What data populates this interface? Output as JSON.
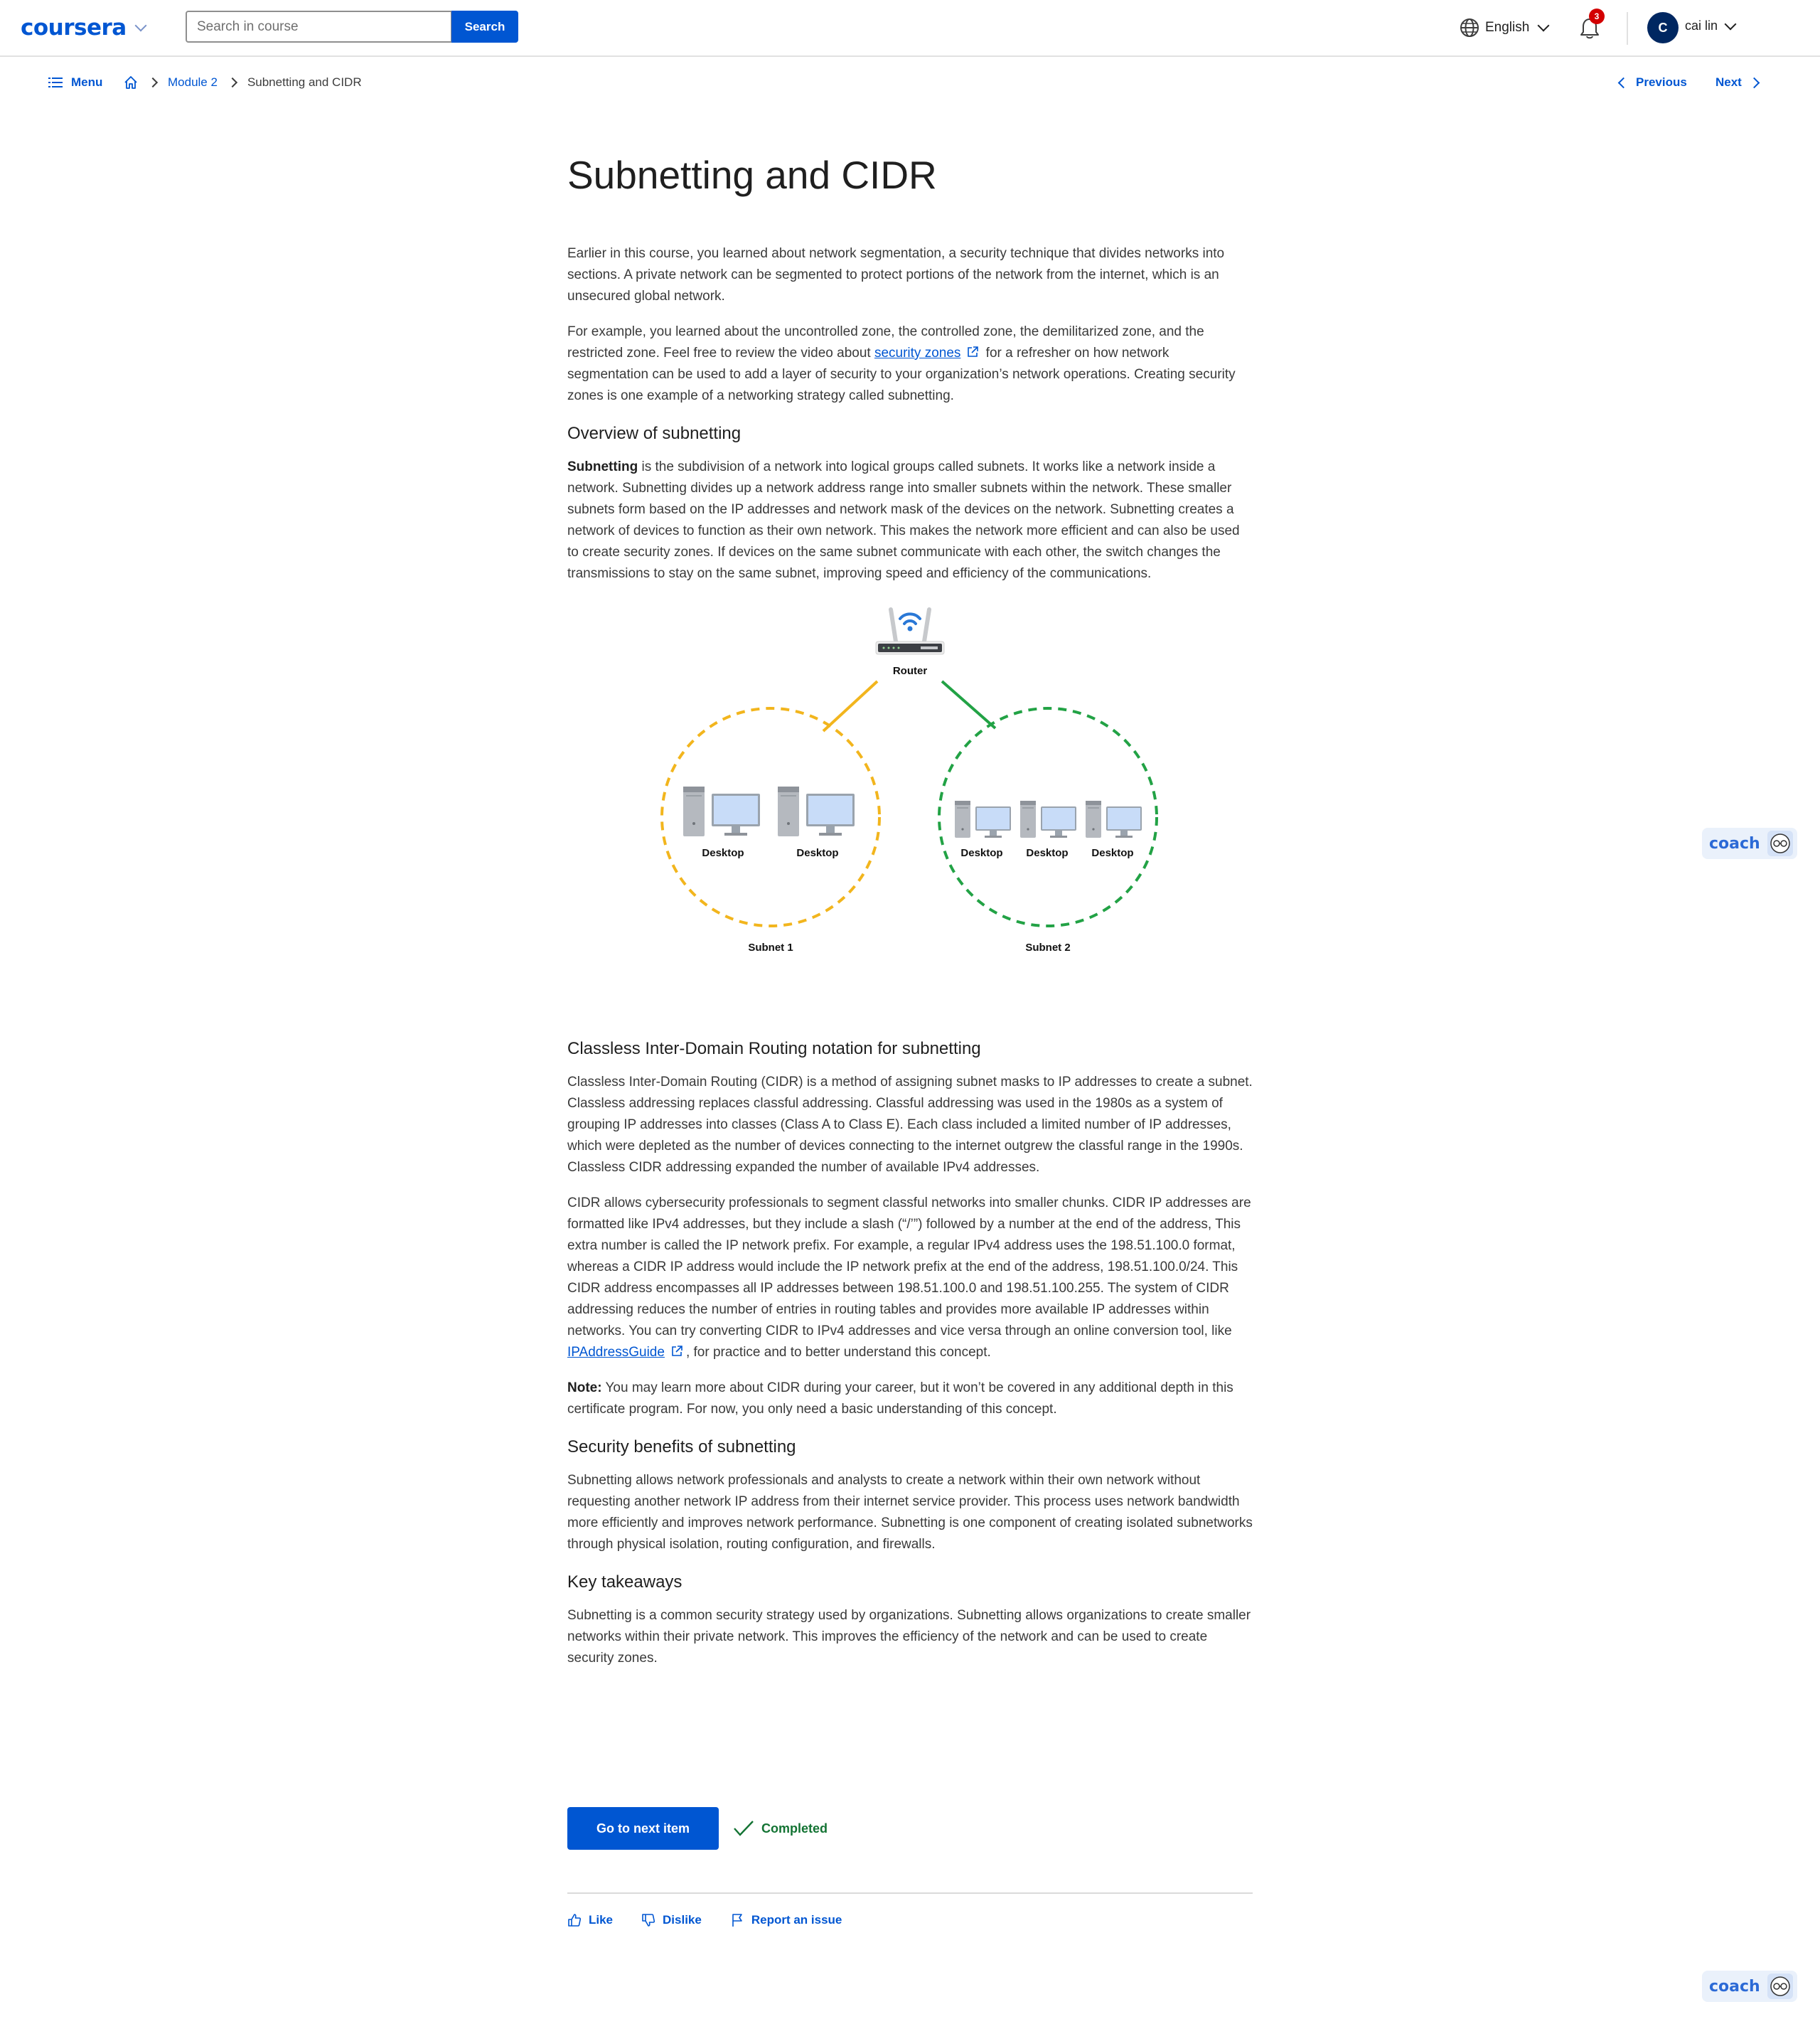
{
  "header": {
    "logo_text": "coursera",
    "search_placeholder": "Search in course",
    "search_button": "Search",
    "language": "English",
    "notification_count": "3",
    "avatar_initial": "C",
    "user_name": "cai lin"
  },
  "subnav": {
    "menu_label": "Menu",
    "breadcrumbs": [
      "Module 2",
      "Subnetting and CIDR"
    ],
    "previous_label": "Previous",
    "next_label": "Next"
  },
  "article": {
    "title": "Subnetting and CIDR",
    "intro_p1": "Earlier in this course, you learned about network segmentation, a security technique that divides networks into sections. A private network can be segmented to protect portions of the network from the internet, which is an unsecured global network.",
    "intro_p2_before": "For example, you learned about the uncontrolled zone, the controlled zone, the demilitarized zone, and the restricted zone. Feel free to review the video about ",
    "intro_p2_link": "security zones",
    "intro_p2_after": " for a refresher on how network segmentation can be used to add a layer of security to your organization’s network operations. Creating security zones is one example of a networking strategy called subnetting.",
    "h_overview": "Overview of subnetting",
    "overview_bold": "Subnetting",
    "overview_rest": " is the subdivision of a network into logical groups called subnets. It works like a network inside a network. Subnetting divides up a network address range into smaller subnets within the network. These smaller subnets form based on the IP addresses and network mask of the devices on the network. Subnetting creates a network of devices to function as their own network. This makes the network more efficient and can also be used to create security zones. If devices on the same subnet communicate with each other, the switch changes the transmissions to stay on the same subnet, improving speed and efficiency of the communications.",
    "h_cidr": "Classless Inter-Domain Routing notation for subnetting",
    "cidr_p1": "Classless Inter-Domain Routing (CIDR) is a method of assigning subnet masks to IP addresses to create a subnet. Classless addressing replaces classful addressing. Classful addressing was used in the 1980s as a system of grouping IP addresses into classes (Class A to Class E). Each class included a limited number of IP addresses, which were depleted as the number of devices connecting to the internet outgrew the classful range in the 1990s. Classless CIDR addressing expanded the number of available IPv4 addresses.",
    "cidr_p2_before": "CIDR allows cybersecurity professionals to segment classful networks into smaller chunks. CIDR IP addresses are formatted like IPv4 addresses, but they include a slash (“/’”) followed by a number at the end of the address, This extra number is called the IP network prefix.  For example, a regular IPv4 address uses the 198.51.100.0 format, whereas a CIDR IP address would include the IP network prefix at the end of the address, 198.51.100.0/24. This CIDR address encompasses all IP addresses between 198.51.100.0 and 198.51.100.255. The system of CIDR addressing reduces the number of entries in routing tables and provides more available IP addresses within networks. You can try converting CIDR to IPv4 addresses and vice versa through an online conversion tool, like ",
    "cidr_p2_link": "IPAddressGuide",
    "cidr_p2_after": ", for practice and to better understand this concept.",
    "note_bold": "Note:",
    "note_rest": " You may learn more about CIDR during your career, but it won’t be covered in any additional depth in this certificate program. For now, you only need a basic understanding of this concept.",
    "h_security": "Security benefits of subnetting",
    "security_p": "Subnetting allows network professionals and analysts to create a network within their own network without requesting another network IP address from their internet service provider. This process uses network bandwidth more efficiently and improves network performance. Subnetting is one component of creating isolated subnetworks through physical isolation, routing configuration, and firewalls.",
    "h_takeaways": "Key takeaways",
    "takeaways_p": "Subnetting is a common security strategy used by organizations. Subnetting allows organizations to create smaller networks within their private network. This improves the efficiency of the network and can be used to create security zones."
  },
  "diagram": {
    "router_label": "Router",
    "desktop_label": "Desktop",
    "subnet1_label": "Subnet 1",
    "subnet2_label": "Subnet 2",
    "subnet1_color": "#f2b51d",
    "subnet2_color": "#22a245"
  },
  "footer": {
    "next_item_label": "Go to next item",
    "completed_label": "Completed",
    "like_label": "Like",
    "dislike_label": "Dislike",
    "report_label": "Report an issue"
  },
  "coach": {
    "label": "coach"
  },
  "colors": {
    "brand": "#0056d2",
    "success": "#137333",
    "badge": "#d30001"
  }
}
